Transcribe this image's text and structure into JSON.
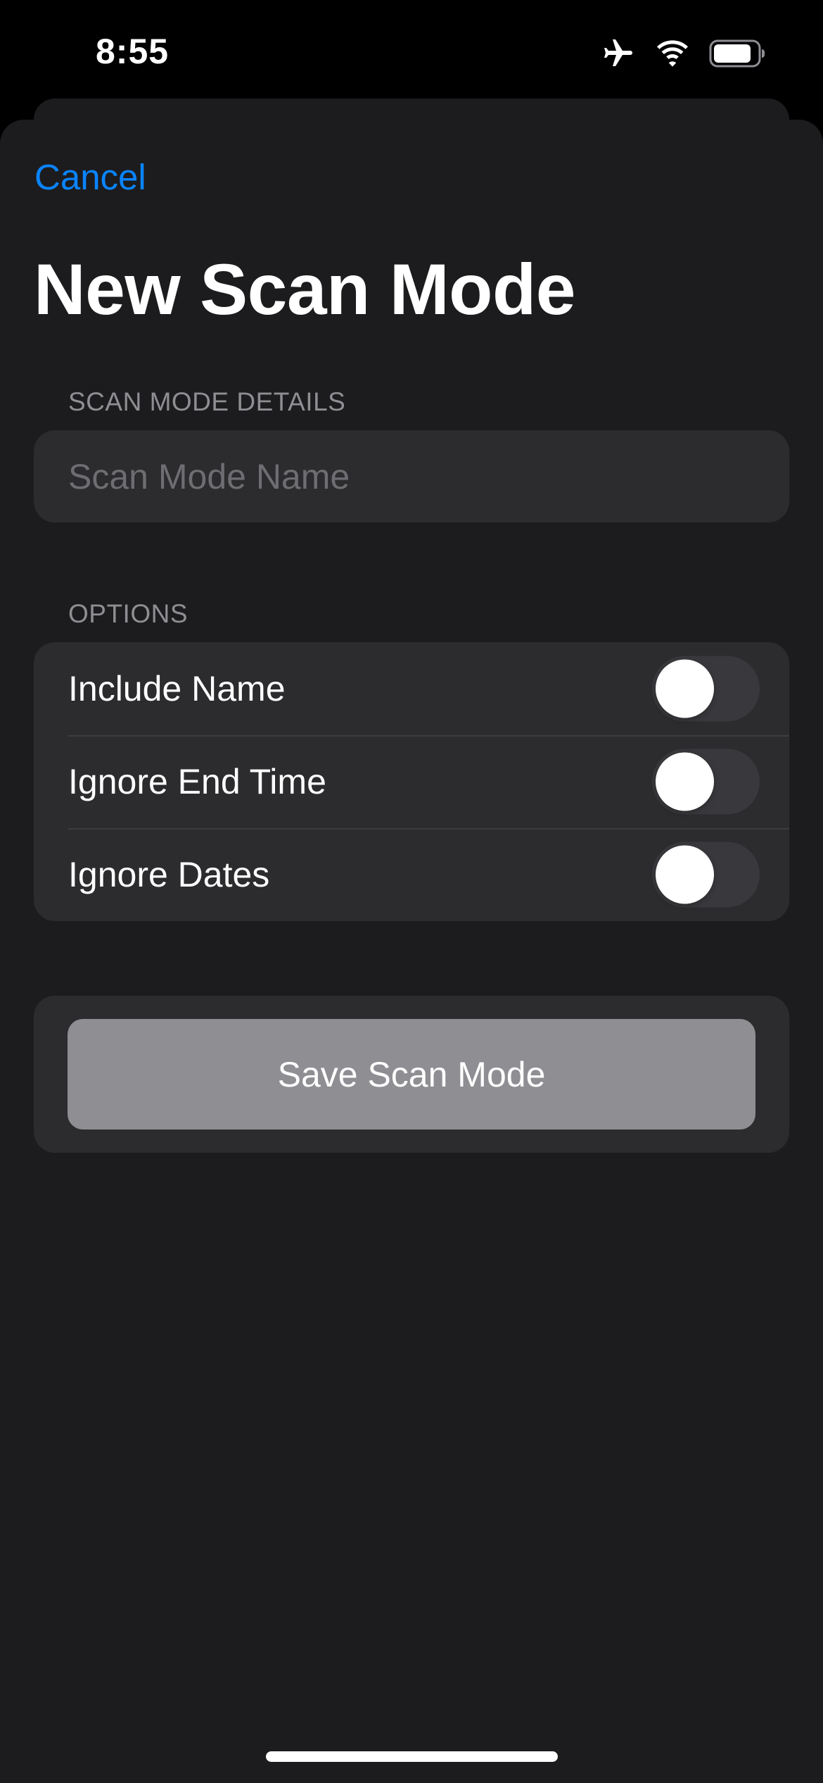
{
  "status_bar": {
    "time": "8:55",
    "icons": [
      "airplane-mode-icon",
      "wifi-icon",
      "battery-icon"
    ]
  },
  "navigation": {
    "cancel_label": "Cancel",
    "title": "New Scan Mode"
  },
  "details_section": {
    "header": "SCAN MODE DETAILS",
    "name_field": {
      "value": "",
      "placeholder": "Scan Mode Name"
    }
  },
  "options_section": {
    "header": "OPTIONS",
    "items": [
      {
        "label": "Include Name",
        "enabled": false
      },
      {
        "label": "Ignore End Time",
        "enabled": false
      },
      {
        "label": "Ignore Dates",
        "enabled": false
      }
    ]
  },
  "save_button": {
    "label": "Save Scan Mode"
  },
  "colors": {
    "background": "#000000",
    "sheet": "#1c1c1e",
    "group": "#2c2c2e",
    "accent": "#0a84ff",
    "secondary_text": "#8e8e93",
    "disabled_button": "#8e8e93"
  }
}
